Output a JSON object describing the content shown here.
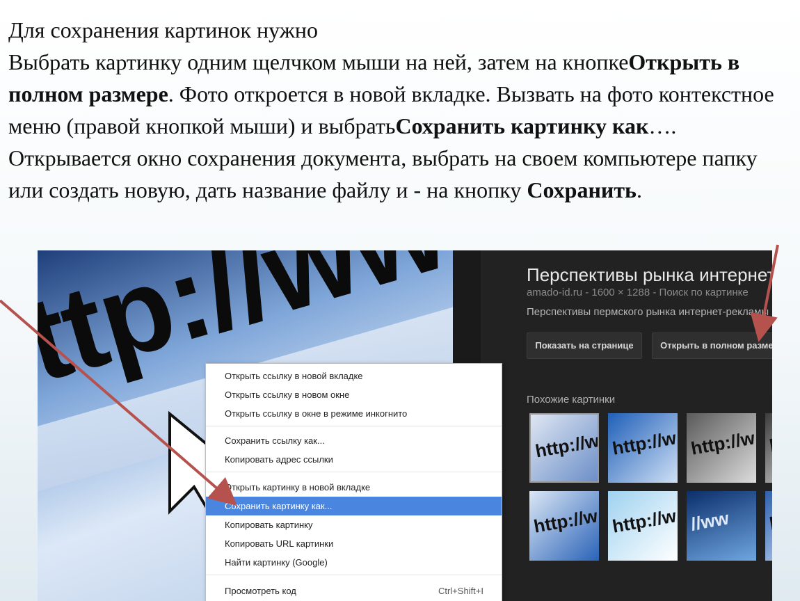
{
  "instructions": {
    "line1": "Для сохранения картинок нужно",
    "p1": "Выбрать картинку одним щелчком мыши на ней, затем на кнопке",
    "b1": "Открыть в полном размере",
    "p2": ". Фото откроется в новой вкладке. Вызвать на фото контекстное меню (правой кнопкой мыши) и выбрать",
    "b2": "Сохранить картинку как",
    "p3": "…. Открывается окно сохранения документа, выбрать на своем компьютере папку или создать новую, дать название файлу и  - на кнопку ",
    "b3": "Сохранить",
    "p4": "."
  },
  "photo": {
    "text": "ttp://www"
  },
  "panel": {
    "title": "Перспективы рынка интернет-р",
    "meta": "amado-id.ru - 1600 × 1288 - Поиск по картинке",
    "description": "Перспективы пермского рынка интернет-рекламы",
    "show_on_page_button": "Показать на странице",
    "open_full_size_button": "Открыть в полном размере",
    "similar_label": "Похожие картинки",
    "thumbs": [
      "http://ww",
      "http://w",
      "http://w",
      "http",
      "http://w",
      "http://w",
      "//ww",
      "http"
    ]
  },
  "context_menu": {
    "items": [
      "Открыть ссылку в новой вкладке",
      "Открыть ссылку в новом окне",
      "Открыть ссылку в окне в режиме инкогнито",
      "Сохранить ссылку как...",
      "Копировать адрес ссылки",
      "Открыть картинку в новой вкладке",
      "Сохранить картинку как...",
      "Копировать картинку",
      "Копировать URL картинки",
      "Найти картинку (Google)",
      "Просмотреть код"
    ],
    "inspect_shortcut": "Ctrl+Shift+I",
    "selected_index": 6
  },
  "colors": {
    "menu_highlight": "#4a86e0",
    "annotation_arrow": "#b5524e",
    "panel_bg": "#222222"
  }
}
